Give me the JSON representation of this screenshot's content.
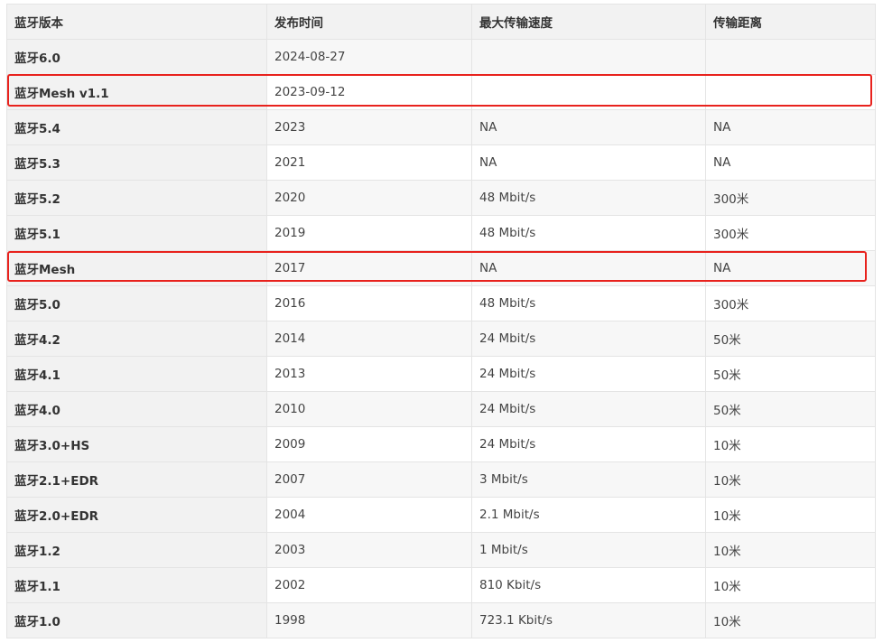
{
  "table": {
    "headers": [
      "蓝牙版本",
      "发布时间",
      "最大传输速度",
      "传输距离"
    ],
    "rows": [
      [
        "蓝牙6.0",
        "2024-08-27",
        "",
        ""
      ],
      [
        "蓝牙Mesh v1.1",
        "2023-09-12",
        "",
        ""
      ],
      [
        "蓝牙5.4",
        "2023",
        "NA",
        "NA"
      ],
      [
        "蓝牙5.3",
        "2021",
        "NA",
        "NA"
      ],
      [
        "蓝牙5.2",
        "2020",
        "48 Mbit/s",
        "300米"
      ],
      [
        "蓝牙5.1",
        "2019",
        "48 Mbit/s",
        "300米"
      ],
      [
        "蓝牙Mesh",
        "2017",
        "NA",
        "NA"
      ],
      [
        "蓝牙5.0",
        "2016",
        "48 Mbit/s",
        "300米"
      ],
      [
        "蓝牙4.2",
        "2014",
        "24 Mbit/s",
        "50米"
      ],
      [
        "蓝牙4.1",
        "2013",
        "24 Mbit/s",
        "50米"
      ],
      [
        "蓝牙4.0",
        "2010",
        "24 Mbit/s",
        "50米"
      ],
      [
        "蓝牙3.0+HS",
        "2009",
        "24 Mbit/s",
        "10米"
      ],
      [
        "蓝牙2.1+EDR",
        "2007",
        "3 Mbit/s",
        "10米"
      ],
      [
        "蓝牙2.0+EDR",
        "2004",
        "2.1 Mbit/s",
        "10米"
      ],
      [
        "蓝牙1.2",
        "2003",
        "1 Mbit/s",
        "10米"
      ],
      [
        "蓝牙1.1",
        "2002",
        "810 Kbit/s",
        "10米"
      ],
      [
        "蓝牙1.0",
        "1998",
        "723.1 Kbit/s",
        "10米"
      ]
    ]
  },
  "highlights": {
    "color": "#e8221d",
    "rows": [
      "蓝牙Mesh v1.1",
      "蓝牙Mesh"
    ]
  }
}
